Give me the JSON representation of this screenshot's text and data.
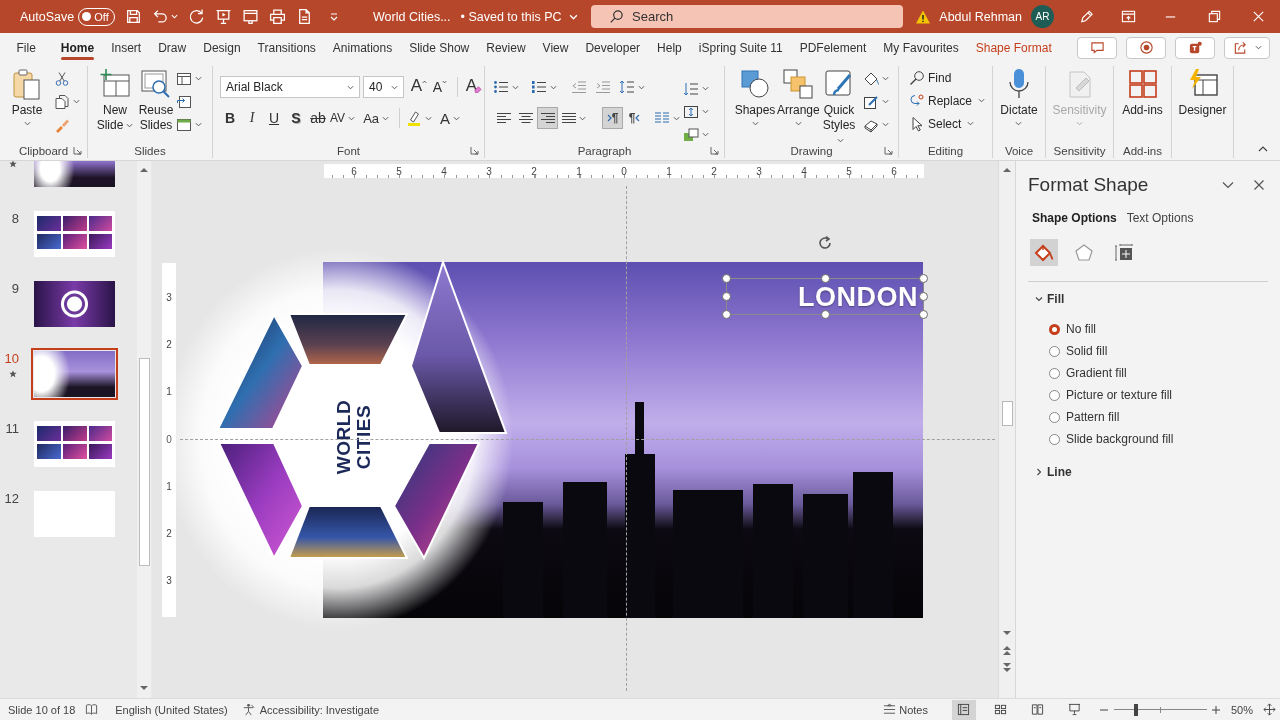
{
  "title_bar": {
    "autosave": "AutoSave",
    "autosave_toggle": {
      "label": "Off",
      "on": false
    },
    "document": "World Cities...",
    "save_status": "• Saved to this PC",
    "search": {
      "placeholder": "Search"
    },
    "user": "Abdul Rehman",
    "avatar": "AR"
  },
  "tabs": [
    {
      "label": "File",
      "selected": false,
      "contextual": false
    },
    {
      "label": "Home",
      "selected": true,
      "contextual": false
    },
    {
      "label": "Insert",
      "selected": false,
      "contextual": false
    },
    {
      "label": "Draw",
      "selected": false,
      "contextual": false
    },
    {
      "label": "Design",
      "selected": false,
      "contextual": false
    },
    {
      "label": "Transitions",
      "selected": false,
      "contextual": false
    },
    {
      "label": "Animations",
      "selected": false,
      "contextual": false
    },
    {
      "label": "Slide Show",
      "selected": false,
      "contextual": false
    },
    {
      "label": "Review",
      "selected": false,
      "contextual": false
    },
    {
      "label": "View",
      "selected": false,
      "contextual": false
    },
    {
      "label": "Developer",
      "selected": false,
      "contextual": false
    },
    {
      "label": "Help",
      "selected": false,
      "contextual": false
    },
    {
      "label": "iSpring Suite 11",
      "selected": false,
      "contextual": false
    },
    {
      "label": "PDFelement",
      "selected": false,
      "contextual": false
    },
    {
      "label": "My Favourites",
      "selected": false,
      "contextual": false
    },
    {
      "label": "Shape Format",
      "selected": false,
      "contextual": true
    }
  ],
  "ribbon": [
    {
      "kind": "clipboard",
      "label": "Clipboard",
      "launcher": true,
      "paste": "Paste"
    },
    {
      "kind": "slides",
      "label": "Slides",
      "new_slide": "New Slide",
      "reuse_slides": "Reuse Slides"
    },
    {
      "kind": "font",
      "label": "Font",
      "launcher": true,
      "font": "Arial Black",
      "size": "40",
      "grow": "A",
      "shrink": "A",
      "clear": "A",
      "styles": [
        {
          "kind": "bold",
          "label": "B",
          "caret": false
        },
        {
          "kind": "italic",
          "label": "I",
          "caret": false
        },
        {
          "kind": "underline",
          "label": "U",
          "caret": false
        },
        {
          "kind": "shadow",
          "label": "S",
          "caret": false
        },
        {
          "kind": "strikethrough",
          "label": "ab",
          "caret": false
        },
        {
          "kind": "spacing",
          "label": "AV",
          "caret": true
        },
        {
          "kind": "case",
          "label": "Aa",
          "caret": true
        }
      ],
      "font_color": "A"
    },
    {
      "kind": "paragraph",
      "label": "Paragraph",
      "launcher": true,
      "align": [
        {
          "kind": "left",
          "selected": false
        },
        {
          "kind": "center",
          "selected": false
        },
        {
          "kind": "right",
          "selected": true
        },
        {
          "kind": "justify",
          "selected": false
        }
      ],
      "direction": [
        {
          "kind": "ltr",
          "label": "¶",
          "selected": true
        },
        {
          "kind": "rtl",
          "label": "¶",
          "selected": false
        }
      ]
    },
    {
      "kind": "drawing",
      "label": "Drawing",
      "launcher": true,
      "shapes": "Shapes",
      "arrange": "Arrange",
      "quick_styles": "Quick Styles"
    },
    {
      "kind": "editing",
      "label": "Editing",
      "find": "Find",
      "replace": "Replace",
      "select": "Select"
    },
    {
      "kind": "voice",
      "label": "Voice",
      "button": "Dictate",
      "disabled": false
    },
    {
      "kind": "sensitivity",
      "label": "Sensitivity",
      "button": "Sensitivity",
      "disabled": true
    },
    {
      "kind": "addins",
      "label": "Add-ins",
      "button": "Add-ins",
      "disabled": false
    },
    {
      "kind": "designer",
      "button": "Designer",
      "disabled": false
    }
  ],
  "slide_panel": {
    "slides": [
      {
        "kind": "cityscape",
        "selected": false,
        "animated": true
      },
      {
        "number": "8",
        "kind": "photo-grid",
        "selected": false,
        "animated": false
      },
      {
        "number": "9",
        "kind": "hexagon",
        "selected": false,
        "animated": false
      },
      {
        "number": "10",
        "kind": "title",
        "selected": true,
        "animated": true
      },
      {
        "number": "11",
        "kind": "photo-grid",
        "selected": false,
        "animated": false
      },
      {
        "number": "12",
        "kind": "blank",
        "selected": false,
        "animated": false
      }
    ]
  },
  "editor": {
    "rulers": {
      "horizontal": [
        "6",
        "5",
        "4",
        "3",
        "2",
        "1",
        "0",
        "1",
        "2",
        "3",
        "4",
        "5",
        "6"
      ],
      "vertical": [
        "3",
        "2",
        "1",
        "0",
        "1",
        "2",
        "3"
      ]
    },
    "slide": {
      "title": "WORLD CITIES",
      "caption": "LONDON",
      "caption_selected": true
    }
  },
  "format_pane": {
    "title": "Format Shape",
    "tabs": [
      {
        "label": "Shape Options",
        "selected": true
      },
      {
        "label": "Text Options",
        "selected": false
      }
    ],
    "categories": [
      {
        "kind": "fill",
        "selected": true
      },
      {
        "kind": "effects",
        "selected": false
      },
      {
        "kind": "size",
        "selected": false
      }
    ],
    "sections": [
      {
        "label": "Fill",
        "expanded": true,
        "options": [
          {
            "label": "No fill",
            "selected": true
          },
          {
            "label": "Solid fill",
            "selected": false
          },
          {
            "label": "Gradient fill",
            "selected": false
          },
          {
            "label": "Picture or texture fill",
            "selected": false
          },
          {
            "label": "Pattern fill",
            "selected": false
          },
          {
            "label": "Slide background fill",
            "selected": false
          }
        ]
      },
      {
        "label": "Line",
        "expanded": false
      }
    ]
  },
  "status_bar": {
    "slide": "Slide 10 of 18",
    "language": "English (United States)",
    "accessibility": "Accessibility: Investigate",
    "notes": "Notes",
    "views": [
      {
        "kind": "normal",
        "selected": true
      },
      {
        "kind": "sorter",
        "selected": false
      },
      {
        "kind": "reading",
        "selected": false
      },
      {
        "kind": "slideshow",
        "selected": false
      }
    ],
    "zoom": {
      "level": 0.24,
      "value": "50%"
    }
  }
}
